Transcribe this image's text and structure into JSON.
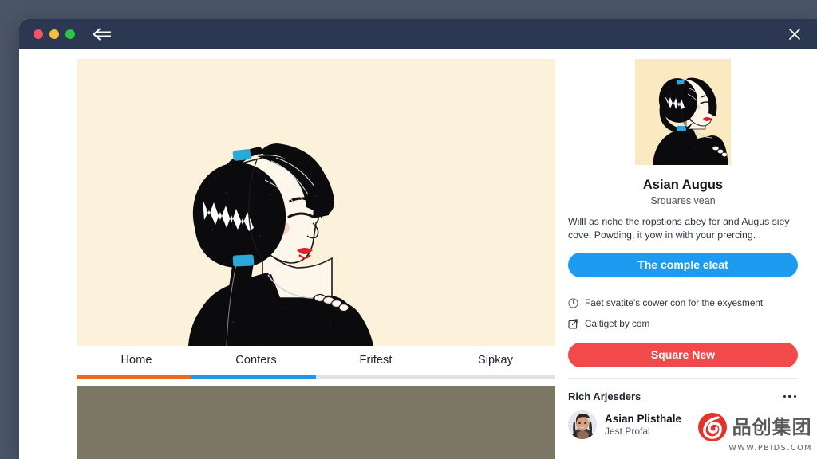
{
  "window": {
    "titlebar": {
      "traffic_lights": [
        {
          "name": "close-light",
          "color": "#f2546a"
        },
        {
          "name": "minimize-light",
          "color": "#f2c037"
        },
        {
          "name": "maximize-light",
          "color": "#28c840"
        }
      ],
      "back_icon": "back-arrow-icon",
      "close_icon": "close-icon",
      "background": "#2c3751"
    }
  },
  "main": {
    "hero": {
      "icon": "illustration-woman-profile",
      "background": "#fcf1db",
      "hair_tie_color": "#2ba7d8",
      "lip_color": "#e01e28"
    },
    "tabs": [
      {
        "label": "Home"
      },
      {
        "label": "Conters"
      },
      {
        "label": "Frifest"
      },
      {
        "label": "Sipkay"
      }
    ],
    "progress": {
      "segments": [
        {
          "name": "orange-segment",
          "percent": 24,
          "color": "#f26722"
        },
        {
          "name": "blue-segment",
          "percent": 26,
          "color": "#2196e8"
        }
      ],
      "track_color": "#e2e2e2"
    },
    "media_block": {
      "color": "#7d7765"
    }
  },
  "side": {
    "thumbnail": {
      "icon": "profile-thumbnail-illustration",
      "background": "#fbe9c2"
    },
    "profile_name": "Asian Augus",
    "profile_subtitle": "Srquares vean",
    "profile_description": "Willl as riche the ropstions abey for and Augus siey cove. Powding, it yow in with your prercing.",
    "primary_button": {
      "label": "The comple eleat",
      "color": "#1d9bf0"
    },
    "meta_rows": [
      {
        "icon": "clock-icon",
        "text": "Faet svatite's cower con for the exyesment"
      },
      {
        "icon": "external-link-icon",
        "text": "Caltiget by com"
      }
    ],
    "secondary_button": {
      "label": "Square New",
      "color": "#f24a4a"
    },
    "section_title": "Rich Arjesders",
    "more_menu_icon": "more-dots-icon",
    "contact": {
      "avatar_icon": "contact-avatar-photo",
      "name": "Asian Plisthale",
      "role": "Jest Profal"
    }
  },
  "watermark": {
    "logo_icon": "pbids-flame-logo",
    "brand_cn": "品创集团",
    "url": "WWW.PBIDS.COM",
    "color": "#58595b",
    "accent": "#e2342a"
  }
}
